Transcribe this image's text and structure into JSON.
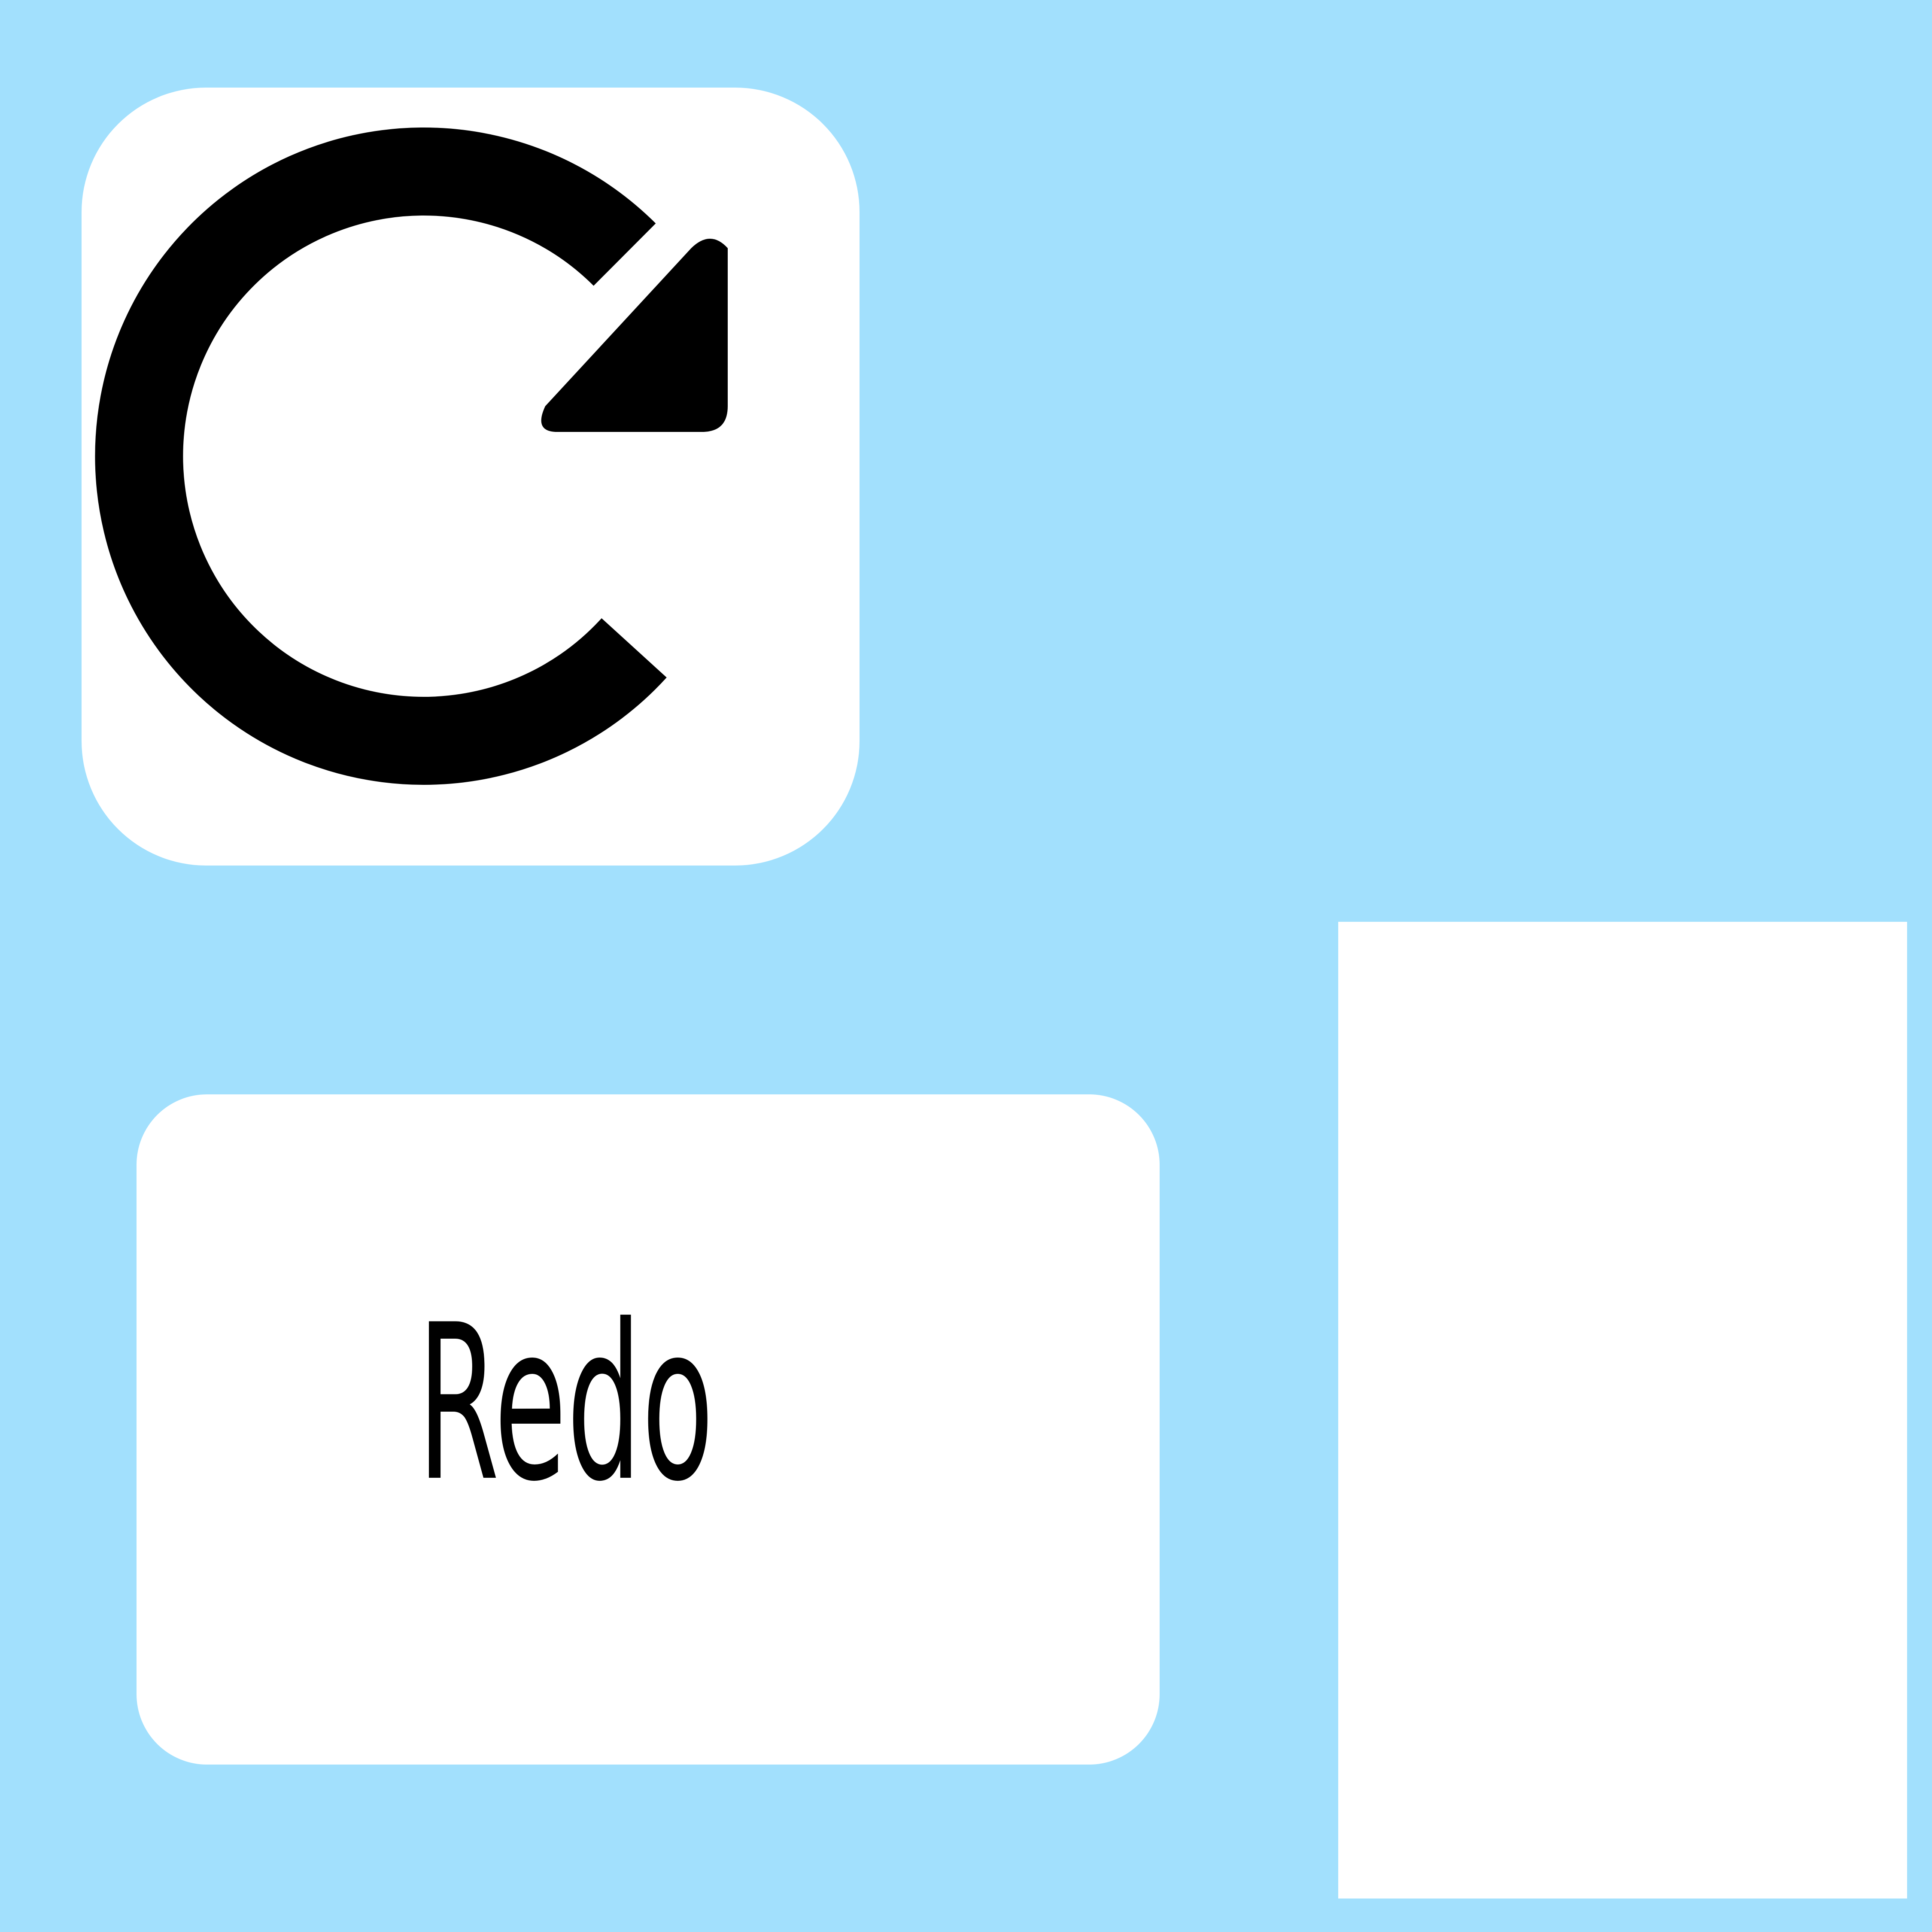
{
  "icon": {
    "name": "redo-icon"
  },
  "label": {
    "text": "Redo"
  },
  "colors": {
    "background": "#a2e0fd",
    "tile": "#ffffff",
    "glyph": "#000000"
  }
}
